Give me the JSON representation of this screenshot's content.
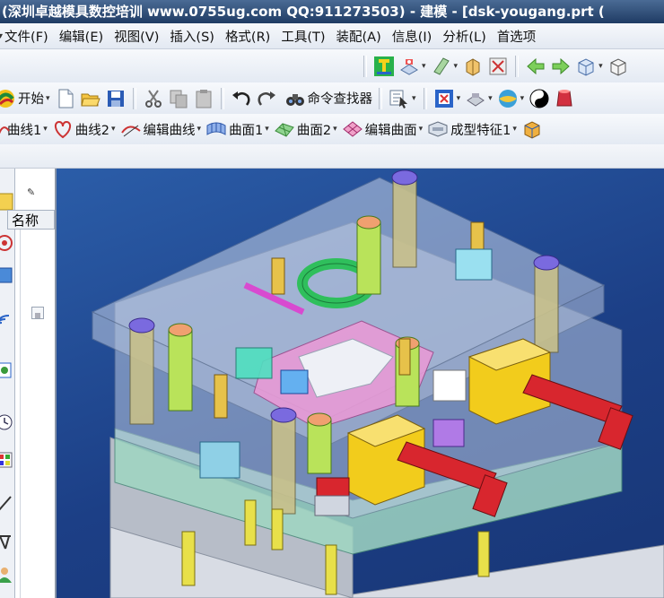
{
  "window": {
    "title": "(深圳卓越模具数控培训  www.0755ug.com  QQ:911273503) - 建模 - [dsk-yougang.prt  ("
  },
  "menu": {
    "items": [
      {
        "label": "文件(F)"
      },
      {
        "label": "编辑(E)"
      },
      {
        "label": "视图(V)"
      },
      {
        "label": "插入(S)"
      },
      {
        "label": "格式(R)"
      },
      {
        "label": "工具(T)"
      },
      {
        "label": "装配(A)"
      },
      {
        "label": "信息(I)"
      },
      {
        "label": "分析(L)"
      },
      {
        "label": "首选项"
      }
    ]
  },
  "toolbar_standard": {
    "start_label": "开始",
    "command_finder_label": "命令查找器"
  },
  "toolbar_surface": {
    "curve1_label": "曲线1",
    "curve2_label": "曲线2",
    "edit_curve_label": "编辑曲线",
    "surface1_label": "曲面1",
    "surface2_label": "曲面2",
    "edit_surface_label": "编辑曲面",
    "form_feature_label": "成型特征1"
  },
  "nav_panel": {
    "header_label": "名称"
  },
  "colors": {
    "titlebar": "#2a4a78",
    "viewport_bg": "#1f4a96",
    "mold_plate": "#c9d2e6",
    "slider_yellow": "#f2cc1c",
    "cylinder_red": "#d8262e",
    "insert_pink": "#e79ad6",
    "ring_green": "#2fbf5c"
  },
  "icons": [
    "mold-wizard-icon",
    "layer-icon",
    "plane-icon",
    "box-icon",
    "x-fit-icon",
    "prev-icon",
    "next-icon",
    "view-cube-icon",
    "new-file-icon",
    "open-folder-icon",
    "save-icon",
    "cut-icon",
    "copy-icon",
    "paste-icon",
    "undo-icon",
    "redo-icon",
    "binoculars-icon",
    "select-filter-icon",
    "snap-icon",
    "render-icon",
    "shade-icon",
    "yin-yang-icon",
    "material-icon"
  ]
}
